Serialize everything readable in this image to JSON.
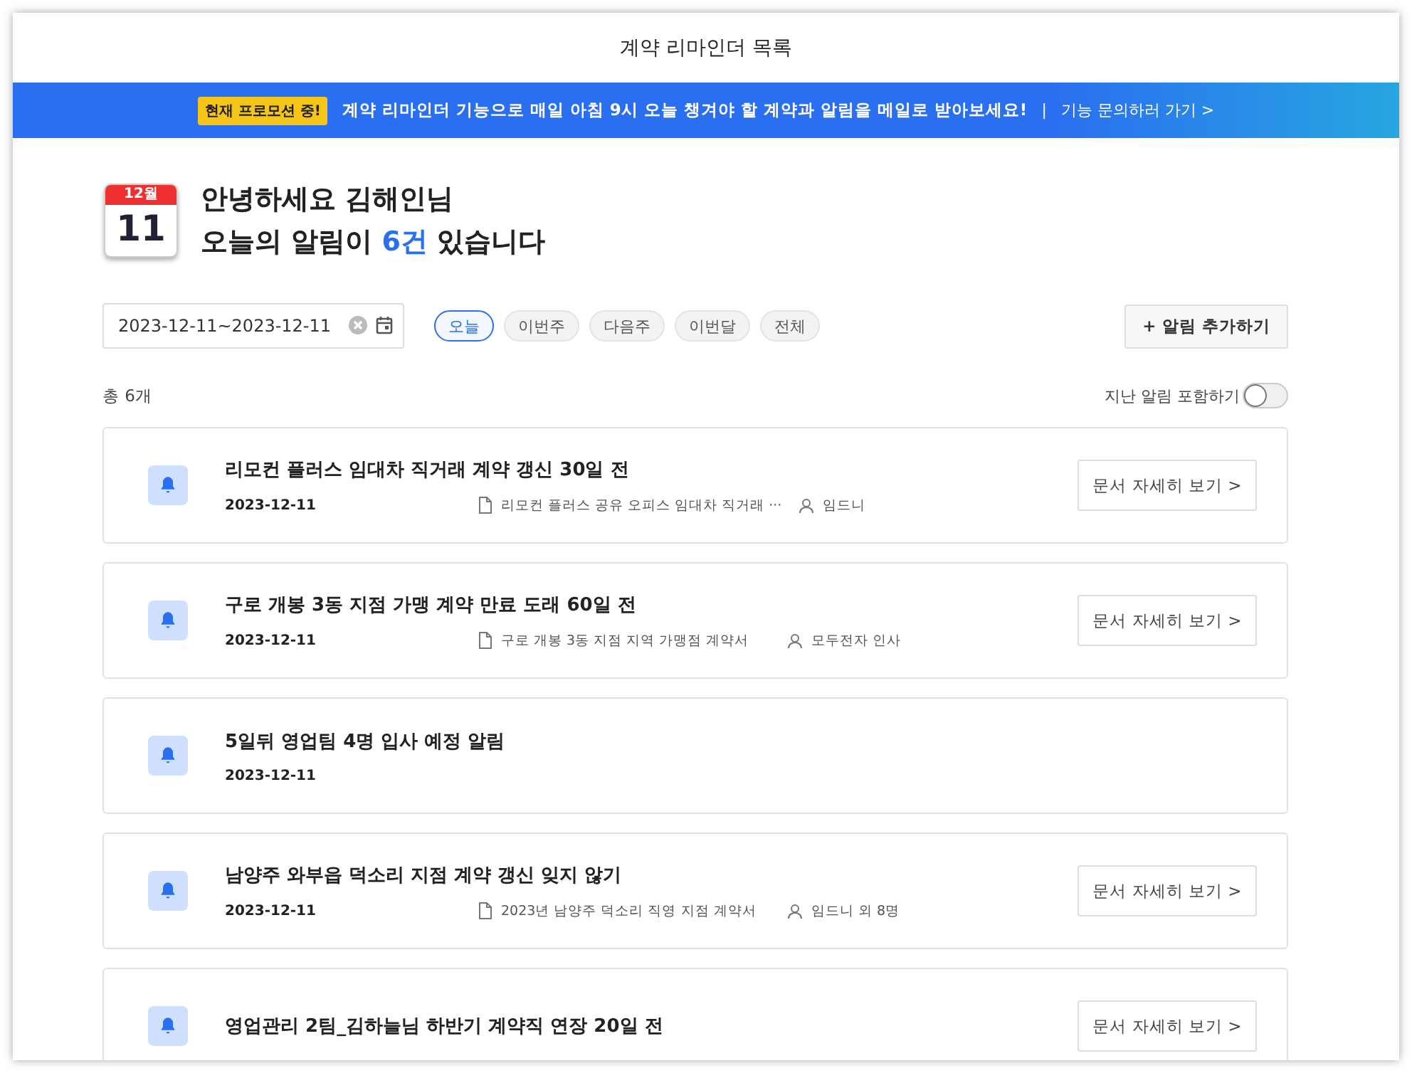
{
  "window": {
    "title": "계약 리마인더 목록"
  },
  "banner": {
    "badge": "현재 프로모션 중!",
    "message": "계약 리마인더 기능으로 매일 아침 9시 오늘 챙겨야 할 계약과 알림을 메일로 받아보세요!",
    "separator": "|",
    "link": "기능 문의하러 가기 >"
  },
  "calendar": {
    "month": "12월",
    "day": "11"
  },
  "greeting": {
    "line1": "안녕하세요 김해인님",
    "line2_before": "오늘의 알림이 ",
    "line2_count": "6건",
    "line2_after": " 있습니다"
  },
  "date_range": {
    "value": "2023-12-11~2023-12-11"
  },
  "filters": [
    {
      "label": "오늘",
      "selected": true
    },
    {
      "label": "이번주",
      "selected": false
    },
    {
      "label": "다음주",
      "selected": false
    },
    {
      "label": "이번달",
      "selected": false
    },
    {
      "label": "전체",
      "selected": false
    }
  ],
  "add_button": "+ 알림 추가하기",
  "total": "총 6개",
  "include_past": {
    "label": "지난 알림 포함하기",
    "on": false
  },
  "reminders": [
    {
      "title": "리모컨 플러스 임대차 직거래 계약 갱신 30일 전",
      "date": "2023-12-11",
      "document": "리모컨 플러스 공유 오피스 임대차 직거래 ···",
      "person": "임드니",
      "button": "문서 자세히 보기 >"
    },
    {
      "title": "구로 개봉 3동 지점 가맹 계약 만료 도래 60일 전",
      "date": "2023-12-11",
      "document": "구로 개봉 3동 지점 지역 가맹점 계약서",
      "person": "모두전자 인사",
      "button": "문서 자세히 보기 >"
    },
    {
      "title": "5일뒤 영업팀 4명 입사 예정 알림",
      "date": "2023-12-11"
    },
    {
      "title": "남양주 와부읍 덕소리 지점 계약 갱신 잊지 않기",
      "date": "2023-12-11",
      "document": "2023년 남양주 덕소리 직영 지점 계약서",
      "person": "임드니 외 8명",
      "button": "문서 자세히 보기 >"
    },
    {
      "title": "영업관리 2팀_김하늘님 하반기 계약직 연장 20일 전",
      "button": "문서 자세히 보기 >"
    }
  ]
}
